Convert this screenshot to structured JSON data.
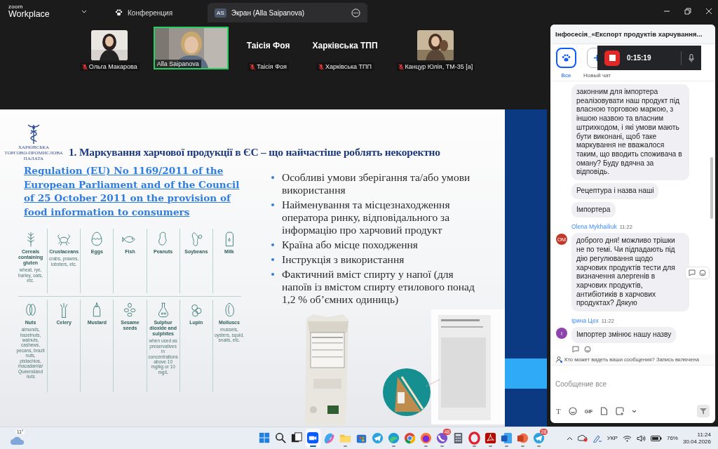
{
  "titlebar": {
    "logo_top": "zoom",
    "logo_bottom": "Workplace",
    "tabs": [
      {
        "kind": "meeting",
        "label": "Конференция",
        "selected": false
      },
      {
        "kind": "screen",
        "badge": "AS",
        "label": "Экран (Alla Saipanova)",
        "selected": true
      }
    ]
  },
  "participants": [
    {
      "name": "Ольга Макарова",
      "muted": true,
      "speaking": false
    },
    {
      "kind": "video",
      "name": "Alla Saipanova",
      "muted": false,
      "speaking": true
    },
    {
      "kind": "name",
      "display": "Таісія Фоя",
      "name": "Таісія Фоя",
      "muted": true,
      "speaking": false
    },
    {
      "kind": "name",
      "display": "Харківська ТПП",
      "name": "Харківська ТПП",
      "muted": true,
      "speaking": false
    },
    {
      "name": "Канцур Юлія, ТМ-35 [a]",
      "muted": true,
      "speaking": false
    }
  ],
  "slide": {
    "logo_lines": [
      "ХАРКІВСЬКА",
      "ТОРГОВО-ПРОМИСЛОВА",
      "ПАЛАТА"
    ],
    "title": "1. Маркування харчової продукції в ЄС – що найчастіше роблять некоректно",
    "link": "Regulation (EU) No 1169/2011 of the European Parliament and of the Council of 25 October 2011 on the provision of food information to consumers",
    "allergen_rows": [
      [
        {
          "kind": "grain",
          "name": "Cereals containing gluten",
          "note": "wheat, rye, barley, oats, etc."
        },
        {
          "kind": "crab",
          "name": "Crustaceans",
          "note": "crabs, prawns, lobsters, etc."
        },
        {
          "kind": "egg",
          "name": "Eggs"
        },
        {
          "kind": "fish",
          "name": "Fish"
        },
        {
          "kind": "peanut",
          "name": "Peanuts"
        },
        {
          "kind": "soy",
          "name": "Soybeans"
        },
        {
          "kind": "milk",
          "name": "Milk"
        }
      ],
      [
        {
          "kind": "nut",
          "name": "Nuts",
          "note": "almonds, hazelnuts, walnuts, cashews, pecans, brazil nuts, pistachios, macadamia/ Queensland nuts"
        },
        {
          "kind": "celery",
          "name": "Celery"
        },
        {
          "kind": "mustard",
          "name": "Mustard"
        },
        {
          "kind": "sesame",
          "name": "Sesame seeds"
        },
        {
          "kind": "flask",
          "name": "Sulphur dioxide and sulphites",
          "note": "when used as preservatives in concentrations above 10 mg/kg or 10 mg/L"
        },
        {
          "kind": "lupin",
          "name": "Lupin"
        },
        {
          "kind": "mollusc",
          "name": "Molluscs",
          "note": "mussels, oysters, squid, snails, etc."
        }
      ]
    ],
    "bullets": [
      "Особливі умови зберігання та/або умови використання",
      "Найменування та місцезнаходження оператора ринку, відповідального за інформацію про харчовий продукт",
      "Країна або місце походження",
      "Інструкція з використання",
      "Фактичний вміст спирту у напої (для напоїв із вмістом спирту етилового понад 1,2 % об’ємних одиниць)"
    ]
  },
  "chat": {
    "title": "Інфосесія_«Експорт продуктів харчування...",
    "tabs": [
      {
        "kind": "all",
        "label": "Все",
        "selected": true
      },
      {
        "kind": "new",
        "label": "Новый чат",
        "selected": false
      }
    ],
    "recording": {
      "time": "0:15:19"
    },
    "messages": [
      {
        "bubbles": [
          "законним для імпортера реалізовувати наш продукт під власною торговою маркою, з іншою назвою та власним штрихкодом, і які умови мають бути виконані, щоб таке маркування не вважалося таким, що вводить споживача в оману? Буду вдячна за відповідь.",
          "Рецептура і назва наші",
          "Імпортера"
        ]
      },
      {
        "sender": "Olena Mykhailiuk",
        "time": "11:22",
        "initials": "OM",
        "color": "#c0392b",
        "bubbles": [
          "доброго дня! можливо трішки не по темі. Чи підпадають під дію регулювання щодо харчових продуктів тести для визначення алергенів в харчових продуктів, антибіотиків в харчових продуктах? Дякую"
        ],
        "hovered": true
      },
      {
        "sender": "Ірина Цех",
        "time": "11:22",
        "initials": "І",
        "color": "#8e44ad",
        "bubbles": [
          "Імпортер змінює нашу назву"
        ],
        "reactions_below": true
      }
    ],
    "notice": "Кто может видеть ваши сообщения? Запись включена",
    "placeholder": "Сообщение все",
    "tools": [
      {
        "kind": "format",
        "label": "T"
      },
      {
        "kind": "emoji"
      },
      {
        "kind": "gif",
        "label": "GIF"
      },
      {
        "kind": "file"
      },
      {
        "kind": "screenshot"
      },
      {
        "kind": "more"
      }
    ]
  },
  "taskbar": {
    "weather": "11°",
    "apps": [
      {
        "kind": "start",
        "running": false,
        "active": false
      },
      {
        "kind": "search",
        "running": false,
        "active": false
      },
      {
        "kind": "taskview",
        "running": false,
        "active": false
      },
      {
        "kind": "zoom",
        "running": true,
        "active": true
      },
      {
        "kind": "copilot",
        "running": false,
        "active": false
      },
      {
        "kind": "explorer",
        "running": true,
        "active": false
      },
      {
        "kind": "store",
        "running": false,
        "active": false
      },
      {
        "kind": "telegram",
        "running": false,
        "active": false
      },
      {
        "kind": "edge",
        "running": true,
        "active": false
      },
      {
        "kind": "chrome",
        "running": false,
        "active": false
      },
      {
        "kind": "firefox",
        "running": true,
        "active": false
      },
      {
        "kind": "viber",
        "running": true,
        "active": false,
        "badge": "48"
      },
      {
        "kind": "calculator",
        "running": false,
        "active": false
      },
      {
        "kind": "opera",
        "running": true,
        "active": false
      },
      {
        "kind": "acrobat",
        "running": true,
        "active": false
      },
      {
        "kind": "word",
        "running": true,
        "active": false
      },
      {
        "kind": "slides",
        "running": true,
        "active": false
      },
      {
        "kind": "telegram",
        "running": true,
        "active": false,
        "badge": "28"
      }
    ],
    "language": "УКР",
    "battery": "76%",
    "time": "11:24",
    "date": "30.04.2026"
  }
}
